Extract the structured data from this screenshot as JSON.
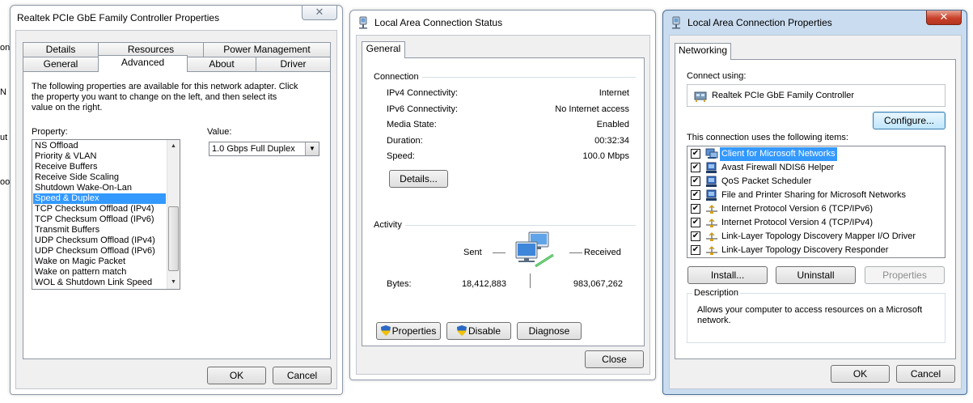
{
  "edge_fragments": [
    "onn",
    "N",
    "ut",
    "oo"
  ],
  "adapter_props": {
    "title": "Realtek PCIe GbE Family Controller Properties",
    "tabs_back": [
      "Details",
      "Resources",
      "Power Management"
    ],
    "tabs_front": [
      "General",
      "Advanced",
      "About",
      "Driver"
    ],
    "active_tab": "Advanced",
    "description": "The following properties are available for this network adapter. Click the property you want to change on the left, and then select its value on the right.",
    "property_label": "Property:",
    "value_label": "Value:",
    "properties": [
      "NS Offload",
      "Priority & VLAN",
      "Receive Buffers",
      "Receive Side Scaling",
      "Shutdown Wake-On-Lan",
      "Speed & Duplex",
      "TCP Checksum Offload (IPv4)",
      "TCP Checksum Offload (IPv6)",
      "Transmit Buffers",
      "UDP Checksum Offload (IPv4)",
      "UDP Checksum Offload (IPv6)",
      "Wake on Magic Packet",
      "Wake on pattern match",
      "WOL & Shutdown Link Speed"
    ],
    "selected_property": "Speed & Duplex",
    "value": "1.0 Gbps Full Duplex",
    "ok": "OK",
    "cancel": "Cancel"
  },
  "status": {
    "title": "Local Area Connection Status",
    "tab": "General",
    "connection_heading": "Connection",
    "rows": [
      {
        "label": "IPv4 Connectivity:",
        "value": "Internet"
      },
      {
        "label": "IPv6 Connectivity:",
        "value": "No Internet access"
      },
      {
        "label": "Media State:",
        "value": "Enabled"
      },
      {
        "label": "Duration:",
        "value": "00:32:34"
      },
      {
        "label": "Speed:",
        "value": "100.0 Mbps"
      }
    ],
    "details_button": "Details...",
    "activity_heading": "Activity",
    "sent_label": "Sent",
    "received_label": "Received",
    "bytes_label": "Bytes:",
    "bytes_sent": "18,412,883",
    "bytes_received": "983,067,262",
    "properties_button": "Properties",
    "disable_button": "Disable",
    "diagnose_button": "Diagnose",
    "close_button": "Close"
  },
  "lan_props": {
    "title": "Local Area Connection Properties",
    "tab": "Networking",
    "connect_using_label": "Connect using:",
    "adapter_name": "Realtek PCIe GbE Family Controller",
    "configure_button": "Configure...",
    "items_label": "This connection uses the following items:",
    "items": [
      {
        "label": "Client for Microsoft Networks",
        "checked": true,
        "icon": "client-icon"
      },
      {
        "label": "Avast Firewall NDIS6 Helper",
        "checked": true,
        "icon": "service-icon"
      },
      {
        "label": "QoS Packet Scheduler",
        "checked": true,
        "icon": "service-icon"
      },
      {
        "label": "File and Printer Sharing for Microsoft Networks",
        "checked": true,
        "icon": "service-icon"
      },
      {
        "label": "Internet Protocol Version 6 (TCP/IPv6)",
        "checked": true,
        "icon": "protocol-icon"
      },
      {
        "label": "Internet Protocol Version 4 (TCP/IPv4)",
        "checked": true,
        "icon": "protocol-icon"
      },
      {
        "label": "Link-Layer Topology Discovery Mapper I/O Driver",
        "checked": true,
        "icon": "protocol-icon"
      },
      {
        "label": "Link-Layer Topology Discovery Responder",
        "checked": true,
        "icon": "protocol-icon"
      }
    ],
    "selected_item": "Client for Microsoft Networks",
    "install_button": "Install...",
    "uninstall_button": "Uninstall",
    "properties_button": "Properties",
    "description_heading": "Description",
    "description_text": "Allows your computer to access resources on a Microsoft network.",
    "ok": "OK",
    "cancel": "Cancel"
  },
  "colors": {
    "selection": "#3399ff",
    "active_frame": "#c9dcf0",
    "close_red": "#c9412a"
  }
}
